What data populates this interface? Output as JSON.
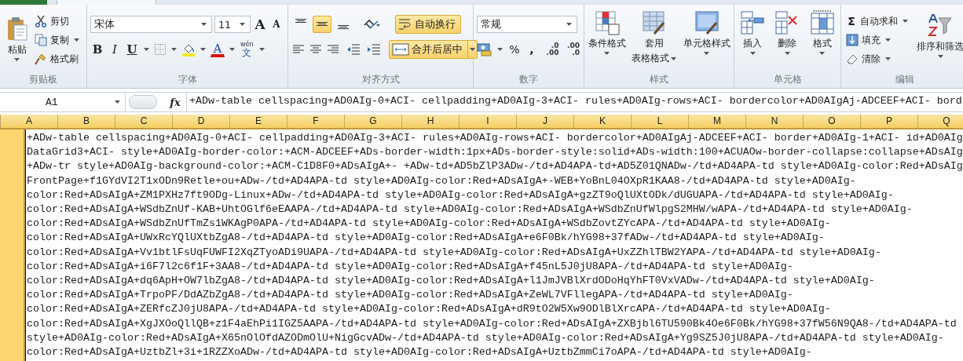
{
  "ribbon": {
    "clipboard": {
      "label": "剪贴板",
      "paste": "粘贴",
      "cut": "剪切",
      "copy": "复制",
      "format_painter": "格式刷"
    },
    "font": {
      "label": "字体",
      "font_name": "宋体",
      "font_size": "11",
      "grow": "A",
      "shrink": "A",
      "bold": "B",
      "italic": "I",
      "underline": "U",
      "font_color": "A",
      "phonetic_pinyin": "wén",
      "phonetic_char": "文"
    },
    "alignment": {
      "label": "对齐方式",
      "vertical": [
        {
          "selected": false
        },
        {
          "selected": true
        },
        {
          "selected": false
        }
      ],
      "horizontal": [
        {
          "selected": false
        },
        {
          "selected": false
        },
        {
          "selected": false
        }
      ],
      "wrap_text": {
        "label": "自动换行",
        "selected": true
      },
      "merge_center": {
        "label": "合并后居中",
        "selected": true
      }
    },
    "number": {
      "label": "数字",
      "format": "常规",
      "percent": "%",
      "comma": ",",
      "decimals": [
        {
          "top": ".0",
          "bottom": ".00"
        },
        {
          "top": ".00",
          "bottom": ".0"
        }
      ]
    },
    "styles": {
      "label": "样式",
      "conditional": "条件格式",
      "table_format_1": "套用",
      "table_format_2": "表格格式",
      "cell_styles": "单元格样式"
    },
    "cells": {
      "label": "单元格",
      "insert": "插入",
      "delete": "删除",
      "format": "格式"
    },
    "editing": {
      "label": "编辑",
      "sigma": "Σ",
      "autosum": "自动求和",
      "fill": "填充",
      "clear": "清除",
      "sort_filter": "排序和筛选"
    }
  },
  "formula_bar": {
    "name_box": "A1",
    "fx": "fx",
    "formula": "+ADw-table cellspacing+AD0AIg-0+ACI- cellpadding+AD0AIg-3+ACI- rules+AD0AIg-rows+ACI- bordercolor+AD0AIgAj-ADCEEF+ACI- bord"
  },
  "sheet": {
    "columns": [
      "A",
      "B",
      "C",
      "D",
      "E",
      "F",
      "G",
      "H",
      "I",
      "J",
      "K",
      "L",
      "M",
      "N",
      "O",
      "P",
      "Q"
    ],
    "cell_lines": [
      "+ADw-table cellspacing+AD0AIg-0+ACI- cellpadding+AD0AIg-3+ACI- rules+AD0AIg-rows+ACI- bordercolor+AD0AIgAj-ADCEEF+ACI- border+AD0AIg-1+ACI- id+AD0AIg",
      "DataGrid3+ACI- style+AD0AIg-border-color:+ACM-ADCEEF+ADs-border-width:1px+ADs-border-style:solid+ADs-width:100+ACUAOw-border-collapse:collapse+ADsAIg",
      "+ADw-tr style+AD0AIg-background-color:+ACM-C1D8F0+ADsAIgA+- +ADw-td+AD5bZlP3ADw-/td+AD4APA-td+AD5Z01QNADw-/td+AD4APA-td style+AD0AIg-color:Red+ADsAIg",
      "FrontPage+f1GYdVI2T1xODn9Retle+ou+ADw-/td+AD4APA-td style+AD0AIg-color:Red+ADsAIgA+-WEB+YoBnL04OXpR1KAA8-/td+AD4APA-td style+AD0AIg-",
      "color:Red+ADsAIgA+ZM1PXHz7ft9ODg-Linux+ADw-/td+AD4APA-td style+AD0AIg-color:Red+ADsAIgA+gzZT9oQlUXtODk/dUGUAPA-/td+AD4APA-td style+AD0AIg-",
      "color:Red+ADsAIgA+WSdbZnUf-KAB+UhtOGlf6eEAAPA-/td+AD4APA-td style+AD0AIg-color:Red+ADsAIgA+WSdbZnUfWlpgS2MHW/wAPA-/td+AD4APA-td style+AD0AIg-",
      "color:Red+ADsAIgA+WSdbZnUfTmZs1WKAgP0APA-/td+AD4APA-td style+AD0AIg-color:Red+ADsAIgA+WSdbZovtZYcAPA-/td+AD4APA-td style+AD0AIg-",
      "color:Red+ADsAIgA+UWxRcYQlUXtbZgA8-/td+AD4APA-td style+AD0AIg-color:Red+ADsAIgA+e6F0Bk/hYG98+37fADw-/td+AD4APA-td style+AD0AIg-",
      "color:Red+ADsAIgA+Vv1btlFsUqFUWFI2XqZTyoADi9UAPA-/td+AD4APA-td style+AD0AIg-color:Red+ADsAIgA+UxZZhlTBW2YAPA-/td+AD4APA-td style+AD0AIg-",
      "color:Red+ADsAIgA+i6F7l2c6f1F+3AA8-/td+AD4APA-td style+AD0AIg-color:Red+ADsAIgA+f45nL5J0jU8APA-/td+AD4APA-td style+AD0AIg-",
      "color:Red+ADsAIgA+dq6ApH+OW7lbZgA8-/td+AD4APA-td style+AD0AIg-color:Red+ADsAIgA+l1JmJVBlXrdODoHqYhFT0VxVADw-/td+AD4APA-td style+AD0AIg-",
      "color:Red+ADsAIgA+TrpoPF/DdAZbZgA8-/td+AD4APA-td style+AD0AIg-color:Red+ADsAIgA+ZeWL7VFllegAPA-/td+AD4APA-td style+AD0AIg-",
      "color:Red+ADsAIgA+ZERfcZJ0jU8APA-/td+AD4APA-td style+AD0AIg-color:Red+ADsAIgA+dR9tO2W5Xw9ODlBlXrcAPA-/td+AD4APA-td style+AD0AIg-",
      "color:Red+ADsAIgA+XgJXOoQllQB+z1F4aEhPi1IGZ5AAPA-/td+AD4APA-td style+AD0AIg-color:Red+ADsAIgA+ZXBjbl6TU590Bk4Oe6F0Bk/hYG98+37fW56N9QA8-/td+AD4APA-td",
      "style+AD0AIg-color:Red+ADsAIgA+X65nOlOfdAZODmOlU+NigGcvADw-/td+AD4APA-td style+AD0AIg-color:Red+ADsAIgA+Yg9SZ5J0jU8APA-/td+AD4APA-td style+AD0AIg-",
      "color:Red+ADsAIgA+UztbZl+3i+1RZZXoADw-/td+AD4APA-td style+AD0AIg-color:Red+ADsAIgA+UztbZmmCi7oAPA-/td+AD4APA-td style+AD0AIg-"
    ]
  }
}
